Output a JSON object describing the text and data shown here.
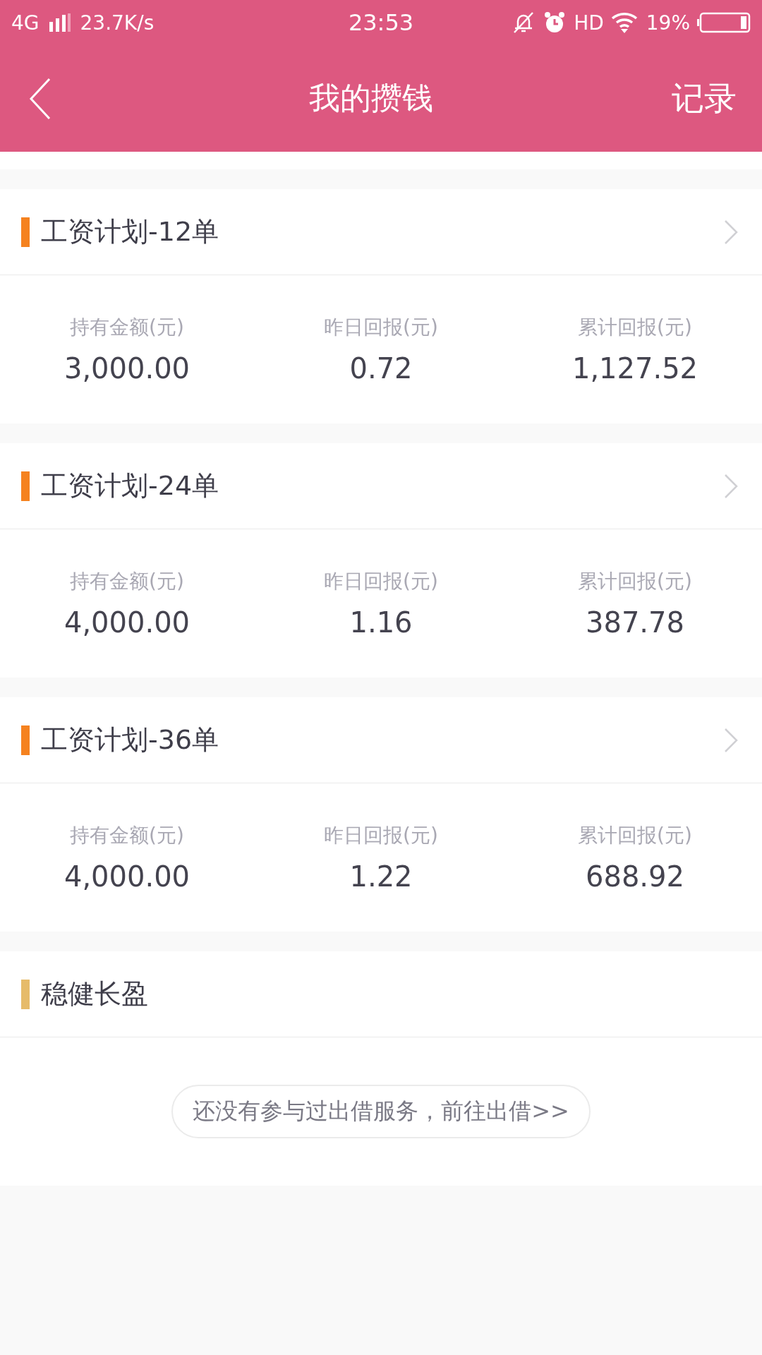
{
  "status_bar": {
    "network": "4G",
    "speed": "23.7K/s",
    "time": "23:53",
    "hd": "HD",
    "battery": "19%"
  },
  "header": {
    "title": "我的攒钱",
    "action": "记录"
  },
  "plans": [
    {
      "title": "工资计划-12单",
      "color": "#f5821f",
      "kind": "stats",
      "stats": [
        {
          "label": "持有金额(元)",
          "value": "3,000.00"
        },
        {
          "label": "昨日回报(元)",
          "value": "0.72"
        },
        {
          "label": "累计回报(元)",
          "value": "1,127.52"
        }
      ]
    },
    {
      "title": "工资计划-24单",
      "color": "#f5821f",
      "kind": "stats",
      "stats": [
        {
          "label": "持有金额(元)",
          "value": "4,000.00"
        },
        {
          "label": "昨日回报(元)",
          "value": "1.16"
        },
        {
          "label": "累计回报(元)",
          "value": "387.78"
        }
      ]
    },
    {
      "title": "工资计划-36单",
      "color": "#f5821f",
      "kind": "stats",
      "stats": [
        {
          "label": "持有金额(元)",
          "value": "4,000.00"
        },
        {
          "label": "昨日回报(元)",
          "value": "1.22"
        },
        {
          "label": "累计回报(元)",
          "value": "688.92"
        }
      ]
    },
    {
      "title": "稳健长盈",
      "color": "#e6bb6a",
      "kind": "empty",
      "message": "还没有参与过出借服务，前往出借>>"
    }
  ]
}
